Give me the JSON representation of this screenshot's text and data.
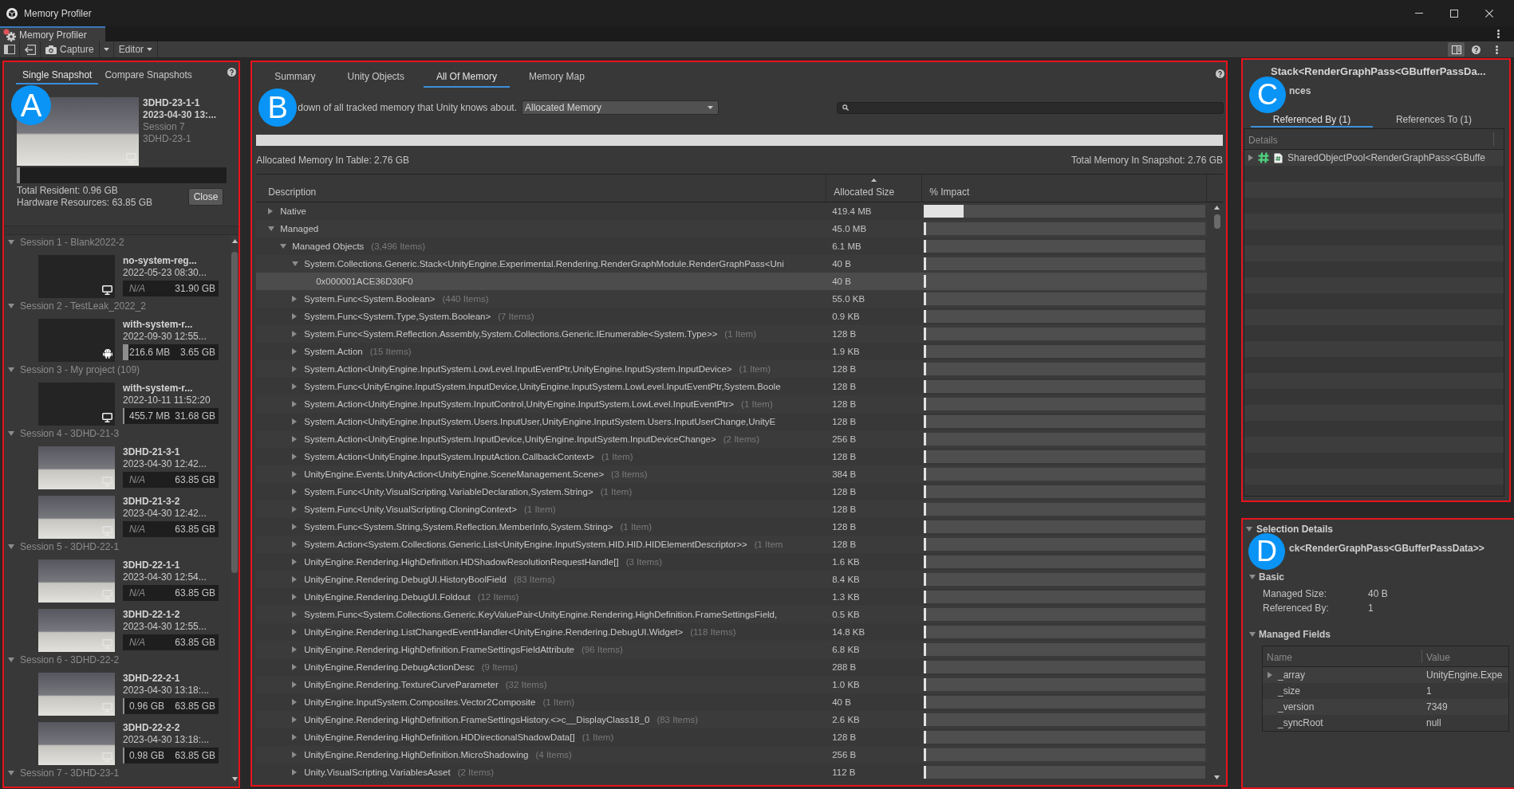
{
  "window": {
    "title": "Memory Profiler",
    "tab": "Memory Profiler"
  },
  "toolbar": {
    "capture": "Capture",
    "target": "Editor"
  },
  "left_panel": {
    "callout": "A",
    "tabs": [
      {
        "label": "Single Snapshot",
        "selected": true
      },
      {
        "label": "Compare Snapshots",
        "selected": false
      }
    ],
    "open_snapshot": {
      "name": "3DHD-23-1-1",
      "date": "2023-04-30 13:...",
      "session": "Session 7",
      "project": "3DHD-23-1",
      "kind": "desktop",
      "screenshot": true,
      "level": 0.015,
      "total_resident": "Total Resident: 0.96 GB",
      "hardware": "Hardware Resources: 63.85 GB",
      "close": "Close"
    },
    "sessions": [
      {
        "title": "Session 1 - Blank2022-2",
        "expanded": true,
        "snapshots": [
          {
            "name": "no-system-reg...",
            "date": "2022-05-23 08:30...",
            "resident": "N/A",
            "total": "31.90 GB",
            "kind": "desktop",
            "screenshot": false
          }
        ]
      },
      {
        "title": "Session 2 - TestLeak_2022_2",
        "expanded": true,
        "snapshots": [
          {
            "name": "with-system-r...",
            "date": "2022-09-30 12:55...",
            "resident": "216.6 MB",
            "total": "3.65 GB",
            "level": 0.055,
            "kind": "android",
            "screenshot": false
          }
        ]
      },
      {
        "title": "Session 3 - My project (109)",
        "expanded": true,
        "snapshots": [
          {
            "name": "with-system-r...",
            "date": "2022-10-11 11:52:20",
            "resident": "455.7 MB",
            "total": "31.68 GB",
            "level": 0.014,
            "kind": "desktop",
            "screenshot": false
          }
        ]
      },
      {
        "title": "Session 4 - 3DHD-21-3",
        "expanded": true,
        "snapshots": [
          {
            "name": "3DHD-21-3-1",
            "date": "2023-04-30 12:42...",
            "resident": "N/A",
            "total": "63.85 GB",
            "kind": "desktop",
            "screenshot": true
          },
          {
            "name": "3DHD-21-3-2",
            "date": "2023-04-30 12:42...",
            "resident": "N/A",
            "total": "63.85 GB",
            "kind": "desktop",
            "screenshot": true
          }
        ]
      },
      {
        "title": "Session 5 - 3DHD-22-1",
        "expanded": true,
        "snapshots": [
          {
            "name": "3DHD-22-1-1",
            "date": "2023-04-30 12:54...",
            "resident": "N/A",
            "total": "63.85 GB",
            "kind": "desktop",
            "screenshot": true
          },
          {
            "name": "3DHD-22-1-2",
            "date": "2023-04-30 12:55...",
            "resident": "N/A",
            "total": "63.85 GB",
            "kind": "desktop",
            "screenshot": true
          }
        ]
      },
      {
        "title": "Session 6 - 3DHD-22-2",
        "expanded": true,
        "snapshots": [
          {
            "name": "3DHD-22-2-1",
            "date": "2023-04-30 13:18:...",
            "resident": "0.96 GB",
            "total": "63.85 GB",
            "level": 0.015,
            "kind": "desktop",
            "screenshot": true
          },
          {
            "name": "3DHD-22-2-2",
            "date": "2023-04-30 13:18:...",
            "resident": "0.98 GB",
            "total": "63.85 GB",
            "level": 0.015,
            "kind": "desktop",
            "screenshot": true
          }
        ]
      },
      {
        "title": "Session 7 - 3DHD-23-1",
        "expanded": true
      }
    ]
  },
  "memory_panel": {
    "callout": "B",
    "tabs": [
      {
        "label": "Summary",
        "selected": false
      },
      {
        "label": "Unity Objects",
        "selected": false
      },
      {
        "label": "All Of Memory",
        "selected": true
      },
      {
        "label": "Memory Map",
        "selected": false
      }
    ],
    "description": "down of all tracked memory that Unity knows about.",
    "mode": "Allocated Memory",
    "level": 1,
    "table_total": "Allocated Memory In Table: 2.76 GB",
    "snapshot_total": "Total Memory In Snapshot: 2.76 GB",
    "table": {
      "columns": [
        {
          "label": "Description",
          "sorted": false
        },
        {
          "label": "Allocated Size",
          "sorted": true
        },
        {
          "label": "% Impact",
          "sorted": false
        }
      ],
      "rows": [
        {
          "description": "Native",
          "size": "419.4 MB",
          "level": 0.14,
          "expanded": false,
          "selected": false
        },
        {
          "description": "Managed",
          "size": "45.0 MB",
          "level": 0.008,
          "expanded": true,
          "selected": false,
          "children": [
            {
              "description": "Managed Objects",
              "count": "(3,496 Items)",
              "size": "6.1 MB",
              "level": 0.008,
              "expanded": true,
              "selected": false,
              "children": [
                {
                  "description": "System.Collections.Generic.Stack<UnityEngine.Experimental.Rendering.RenderGraphModule.RenderGraphPass<Uni",
                  "size": "40 B",
                  "level": 0.008,
                  "expanded": true,
                  "selected": false,
                  "children": [
                    {
                      "description": "0x000001ACE36D30F0",
                      "size": "40 B",
                      "level": 0.008,
                      "selected": true
                    }
                  ]
                },
                {
                  "description": "System.Func<System.Boolean>",
                  "count": "(440 Items)",
                  "size": "55.0 KB",
                  "level": 0.008,
                  "expanded": false,
                  "selected": false
                },
                {
                  "description": "System.Func<System.Type,System.Boolean>",
                  "count": "(7 Items)",
                  "size": "0.9 KB",
                  "level": 0.008,
                  "expanded": false,
                  "selected": false
                },
                {
                  "description": "System.Func<System.Reflection.Assembly,System.Collections.Generic.IEnumerable<System.Type>>",
                  "count": "(1 Item)",
                  "size": "128 B",
                  "level": 0.008,
                  "expanded": false,
                  "selected": false
                },
                {
                  "description": "System.Action",
                  "count": "(15 Items)",
                  "size": "1.9 KB",
                  "level": 0.008,
                  "expanded": false,
                  "selected": false
                },
                {
                  "description": "System.Action<UnityEngine.InputSystem.LowLevel.InputEventPtr,UnityEngine.InputSystem.InputDevice>",
                  "count": "(1 Item)",
                  "size": "128 B",
                  "level": 0.008,
                  "expanded": false,
                  "selected": false
                },
                {
                  "description": "System.Func<UnityEngine.InputSystem.InputDevice,UnityEngine.InputSystem.LowLevel.InputEventPtr,System.Boole",
                  "size": "128 B",
                  "level": 0.008,
                  "expanded": false,
                  "selected": false
                },
                {
                  "description": "System.Action<UnityEngine.InputSystem.InputControl,UnityEngine.InputSystem.LowLevel.InputEventPtr>",
                  "count": "(1 Item)",
                  "size": "128 B",
                  "level": 0.008,
                  "expanded": false,
                  "selected": false
                },
                {
                  "description": "System.Action<UnityEngine.InputSystem.Users.InputUser,UnityEngine.InputSystem.Users.InputUserChange,UnityE",
                  "size": "128 B",
                  "level": 0.008,
                  "expanded": false,
                  "selected": false
                },
                {
                  "description": "System.Action<UnityEngine.InputSystem.InputDevice,UnityEngine.InputSystem.InputDeviceChange>",
                  "count": "(2 Items)",
                  "size": "256 B",
                  "level": 0.008,
                  "expanded": false,
                  "selected": false
                },
                {
                  "description": "System.Action<UnityEngine.InputSystem.InputAction.CallbackContext>",
                  "count": "(1 Item)",
                  "size": "128 B",
                  "level": 0.008,
                  "expanded": false,
                  "selected": false
                },
                {
                  "description": "UnityEngine.Events.UnityAction<UnityEngine.SceneManagement.Scene>",
                  "count": "(3 Items)",
                  "size": "384 B",
                  "level": 0.008,
                  "expanded": false,
                  "selected": false
                },
                {
                  "description": "System.Func<Unity.VisualScripting.VariableDeclaration,System.String>",
                  "count": "(1 Item)",
                  "size": "128 B",
                  "level": 0.008,
                  "expanded": false,
                  "selected": false
                },
                {
                  "description": "System.Func<Unity.VisualScripting.CloningContext>",
                  "count": "(1 Item)",
                  "size": "128 B",
                  "level": 0.008,
                  "expanded": false,
                  "selected": false
                },
                {
                  "description": "System.Func<System.String,System.Reflection.MemberInfo,System.String>",
                  "count": "(1 Item)",
                  "size": "128 B",
                  "level": 0.008,
                  "expanded": false,
                  "selected": false
                },
                {
                  "description": "System.Action<System.Collections.Generic.List<UnityEngine.InputSystem.HID.HID.HIDElementDescriptor>>",
                  "count": "(1 Item",
                  "size": "128 B",
                  "level": 0.008,
                  "expanded": false,
                  "selected": false
                },
                {
                  "description": "UnityEngine.Rendering.HighDefinition.HDShadowResolutionRequestHandle[]",
                  "count": "(3 Items)",
                  "size": "1.6 KB",
                  "level": 0.008,
                  "expanded": false,
                  "selected": false
                },
                {
                  "description": "UnityEngine.Rendering.DebugUI.HistoryBoolField",
                  "count": "(83 Items)",
                  "size": "8.4 KB",
                  "level": 0.008,
                  "expanded": false,
                  "selected": false
                },
                {
                  "description": "UnityEngine.Rendering.DebugUI.Foldout",
                  "count": "(12 Items)",
                  "size": "1.3 KB",
                  "level": 0.008,
                  "expanded": false,
                  "selected": false
                },
                {
                  "description": "System.Func<System.Collections.Generic.KeyValuePair<UnityEngine.Rendering.HighDefinition.FrameSettingsField,",
                  "size": "0.5 KB",
                  "level": 0.008,
                  "expanded": false,
                  "selected": false
                },
                {
                  "description": "UnityEngine.Rendering.ListChangedEventHandler<UnityEngine.Rendering.DebugUI.Widget>",
                  "count": "(118 Items)",
                  "size": "14.8 KB",
                  "level": 0.008,
                  "expanded": false,
                  "selected": false
                },
                {
                  "description": "UnityEngine.Rendering.HighDefinition.FrameSettingsFieldAttribute",
                  "count": "(96 Items)",
                  "size": "6.8 KB",
                  "level": 0.008,
                  "expanded": false,
                  "selected": false
                },
                {
                  "description": "UnityEngine.Rendering.DebugActionDesc",
                  "count": "(9 Items)",
                  "size": "288 B",
                  "level": 0.008,
                  "expanded": false,
                  "selected": false
                },
                {
                  "description": "UnityEngine.Rendering.TextureCurveParameter",
                  "count": "(32 Items)",
                  "size": "1.0 KB",
                  "level": 0.008,
                  "expanded": false,
                  "selected": false
                },
                {
                  "description": "UnityEngine.InputSystem.Composites.Vector2Composite",
                  "count": "(1 Item)",
                  "size": "40 B",
                  "level": 0.008,
                  "expanded": false,
                  "selected": false
                },
                {
                  "description": "UnityEngine.Rendering.HighDefinition.FrameSettingsHistory.<>c__DisplayClass18_0",
                  "count": "(83 Items)",
                  "size": "2.6 KB",
                  "level": 0.008,
                  "expanded": false,
                  "selected": false
                },
                {
                  "description": "UnityEngine.Rendering.HighDefinition.HDDirectionalShadowData[]",
                  "count": "(1 Item)",
                  "size": "128 B",
                  "level": 0.008,
                  "expanded": false,
                  "selected": false
                },
                {
                  "description": "UnityEngine.Rendering.HighDefinition.MicroShadowing",
                  "count": "(4 Items)",
                  "size": "256 B",
                  "level": 0.008,
                  "expanded": false,
                  "selected": false
                },
                {
                  "description": "Unity.VisualScripting.VariablesAsset",
                  "count": "(2 Items)",
                  "size": "112 B",
                  "level": 0.008,
                  "expanded": false,
                  "selected": false
                }
              ]
            }
          ]
        }
      ]
    }
  },
  "references_panel": {
    "callout": "C",
    "title": "Stack<RenderGraphPass<GBufferPassDa...",
    "section": "nces",
    "tabs": [
      {
        "label": "Referenced By (1)",
        "selected": true
      },
      {
        "label": "References To (1)",
        "selected": false
      }
    ],
    "column": "Details",
    "items": [
      {
        "label": "SharedObjectPool<RenderGraphPass<GBuffe",
        "expanded": false,
        "selected": false
      }
    ]
  },
  "details_panel": {
    "callout": "D",
    "title": "Selection Details",
    "expanded": true,
    "object": "ck<RenderGraphPass<GBufferPassData>>",
    "sections": [
      {
        "kind": "properties",
        "title": "Basic",
        "expanded": true,
        "properties": [
          {
            "label": "Managed Size:",
            "value": "40 B"
          },
          {
            "label": "Referenced By:",
            "value": "1"
          }
        ]
      },
      {
        "kind": "table",
        "title": "Managed Fields",
        "expanded": true,
        "columns": [
          "Name",
          "Value"
        ],
        "rows": [
          {
            "name": "_array",
            "value": "UnityEngine.Expe",
            "expanded": false
          },
          {
            "name": "_size",
            "value": "1"
          },
          {
            "name": "_version",
            "value": "7349"
          },
          {
            "name": "_syncRoot",
            "value": "null"
          }
        ]
      }
    ]
  }
}
